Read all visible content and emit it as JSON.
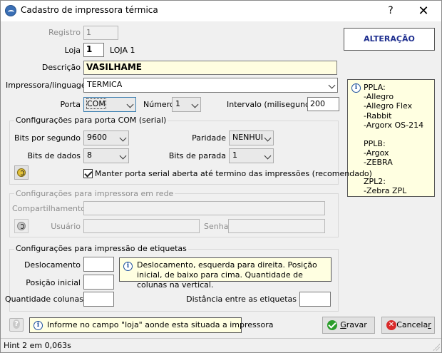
{
  "window": {
    "title": "Cadastro de impressora térmica",
    "help_glyph": "?",
    "close_glyph": "✕"
  },
  "form": {
    "registro_label": "Registro",
    "registro_value": "1",
    "loja_label": "Loja",
    "loja_value": "1",
    "loja_name": "LOJA 1",
    "descricao_label": "Descrição",
    "descricao_value": "VASILHAME",
    "impressora_label": "Impressora/linguagem",
    "impressora_value": "TERMICA",
    "porta_label": "Porta",
    "porta_value": "COM",
    "numero_label": "Número",
    "numero_value": "1",
    "intervalo_label": "Intervalo (milisegundos)",
    "intervalo_value": "200"
  },
  "mode_badge": "ALTERAÇÃO",
  "com_group": {
    "title": "Configurações para porta COM (serial)",
    "bits_segundo_label": "Bits por segundo",
    "bits_segundo_value": "9600",
    "paridade_label": "Paridade",
    "paridade_value": "NENHUI",
    "bits_dados_label": "Bits de dados",
    "bits_dados_value": "8",
    "bits_parada_label": "Bits de parada",
    "bits_parada_value": "1",
    "manter_label": "Manter porta serial aberta até termino das impressões (recomendado)",
    "manter_checked": true
  },
  "rede_group": {
    "title": "Configurações para impressora em rede",
    "compartilhamento_label": "Compartilhamento",
    "usuario_label": "Usuário",
    "senha_label": "Senha"
  },
  "etiquetas_group": {
    "title": "Configurações para impressão de etiquetas",
    "deslocamento_label": "Deslocamento",
    "posicao_label": "Posição inicial",
    "quantidade_label": "Quantidade colunas",
    "distancia_label": "Distância entre as etiquetas",
    "hint": "Deslocamento, esquerda para direita. Posição inicial, de baixo para cima. Quantidade de colunas na vertical."
  },
  "languages_info": {
    "lines": [
      "PPLA:",
      "-Allegro",
      "-Allegro Flex",
      "-Rabbit",
      "-Argorx OS-214",
      "",
      "PPLB:",
      "-Argox",
      "-ZEBRA",
      "",
      "ZPL2:",
      "-Zebra ZPL"
    ]
  },
  "footer": {
    "tip": "Informe no campo \"loja\" aonde esta situada a impressora",
    "gravar_first": "G",
    "gravar_rest": "ravar",
    "cancelar_main": "Cancela",
    "cancelar_last": "r"
  },
  "status": {
    "text": "Hint 2 em 0,063s"
  },
  "colors": {
    "badge_text": "#1f2f8f",
    "info_bg": "#ffffe1",
    "input_yellow": "#fffde0"
  }
}
